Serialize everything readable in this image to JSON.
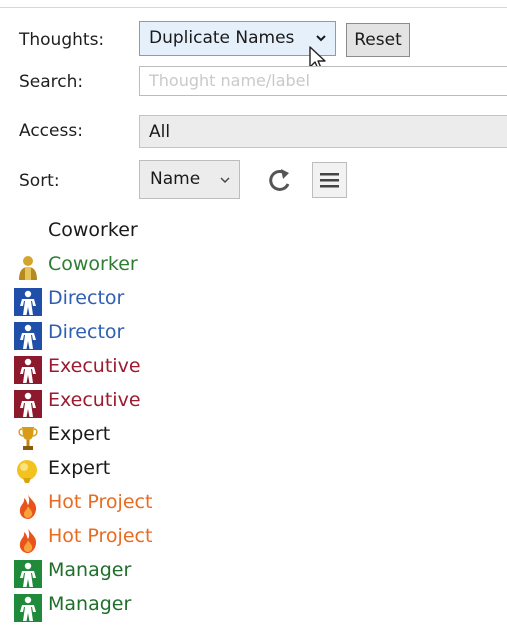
{
  "labels": {
    "thoughts": "Thoughts:",
    "search": "Search:",
    "access": "Access:",
    "sort": "Sort:"
  },
  "thoughts_select": {
    "value": "Duplicate Names"
  },
  "reset_button": {
    "label": "Reset"
  },
  "search": {
    "placeholder": "Thought name/label"
  },
  "access_select": {
    "value": "All"
  },
  "sort_select": {
    "value": "Name"
  },
  "toolbar_icons": {
    "refresh": "refresh-icon",
    "list": "list-view-icon"
  },
  "colors": {
    "black": "#1a1a1a",
    "green": "#2e7d32",
    "blue": "#2f5fb3",
    "darkred": "#9b1b30",
    "orange": "#ea6a1f",
    "manager_green": "#1f6f2b"
  },
  "thoughts": [
    {
      "name": "Coworker",
      "icon": "none",
      "color": "#1a1a1a"
    },
    {
      "name": "Coworker",
      "icon": "person-gold-icon",
      "color": "#2e7d32"
    },
    {
      "name": "Director",
      "icon": "person-blue-icon",
      "color": "#2f5fb3"
    },
    {
      "name": "Director",
      "icon": "person-blue-icon",
      "color": "#2f5fb3"
    },
    {
      "name": "Executive",
      "icon": "person-red-icon",
      "color": "#9b1b30"
    },
    {
      "name": "Executive",
      "icon": "person-red-icon",
      "color": "#9b1b30"
    },
    {
      "name": "Expert",
      "icon": "trophy-icon",
      "color": "#1a1a1a"
    },
    {
      "name": "Expert",
      "icon": "lightbulb-icon",
      "color": "#1a1a1a"
    },
    {
      "name": "Hot Project",
      "icon": "flame-icon",
      "color": "#ea6a1f"
    },
    {
      "name": "Hot Project",
      "icon": "flame-icon",
      "color": "#ea6a1f"
    },
    {
      "name": "Manager",
      "icon": "person-green-icon",
      "color": "#1f6f2b"
    },
    {
      "name": "Manager",
      "icon": "person-green-icon",
      "color": "#1f6f2b"
    }
  ]
}
